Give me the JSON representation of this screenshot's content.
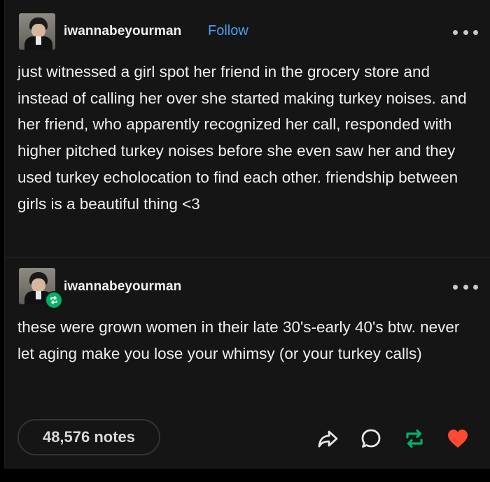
{
  "post": {
    "author": "iwannabeyourman",
    "follow_label": "Follow",
    "text": "just witnessed a girl spot her friend in the grocery store and instead of calling her over she started making turkey noises. and her friend, who apparently recognized her call, responded with higher pitched turkey noises before she even saw her and they used turkey echolocation to find each other. friendship between girls is a beautiful thing <3"
  },
  "reblog": {
    "author": "iwannabeyourman",
    "text": "these were grown women in their late 30's-early 40's btw. never let aging make you lose your whimsy (or your turkey calls)"
  },
  "footer": {
    "notes_label": "48,576 notes"
  },
  "colors": {
    "background": "#151515",
    "follow": "#4c9cf0",
    "reblog": "#00b16a",
    "like": "#ff4930"
  },
  "icons": {
    "more": "more-dots-icon",
    "share": "share-icon",
    "reply": "reply-icon",
    "reblog": "reblog-icon",
    "like": "heart-icon"
  }
}
